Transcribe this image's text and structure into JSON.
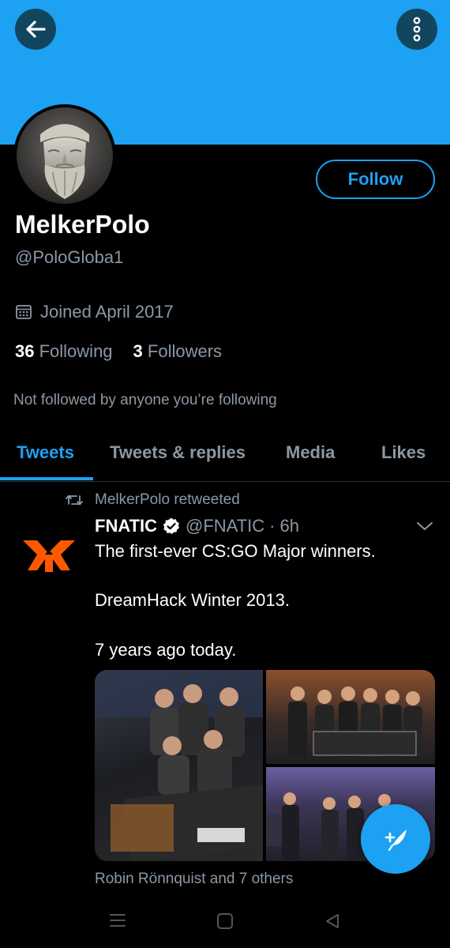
{
  "profile": {
    "display_name": "MelkerPolo",
    "handle": "@PoloGloba1",
    "joined": "Joined April 2017",
    "following_count": "36",
    "following_label": "Following",
    "followers_count": "3",
    "followers_label": "Followers",
    "not_followed": "Not followed by anyone you’re following",
    "follow_label": "Follow"
  },
  "tabs": [
    {
      "label": "Tweets",
      "active": true
    },
    {
      "label": "Tweets & replies",
      "active": false
    },
    {
      "label": "Media",
      "active": false
    },
    {
      "label": "Likes",
      "active": false
    }
  ],
  "tweet": {
    "retweet_line": "MelkerPolo retweeted",
    "author_name": "FNATIC",
    "author_handle": "@FNATIC",
    "separator": "·",
    "time": "6h",
    "lines": [
      "The first-ever CS:GO Major winners.",
      "DreamHack Winter 2013.",
      "7 years ago today."
    ],
    "liked_by": "Robin Rönnquist and 7 others"
  },
  "colors": {
    "accent": "#1da1f2",
    "background": "#000000",
    "secondary_text": "#8b98a5",
    "fnatic_orange": "#ff5900"
  },
  "icons": [
    "back-arrow-icon",
    "more-vertical-icon",
    "calendar-icon",
    "retweet-icon",
    "verified-badge-icon",
    "chevron-down-icon",
    "compose-tweet-icon",
    "recents-icon",
    "home-icon",
    "back-icon"
  ]
}
